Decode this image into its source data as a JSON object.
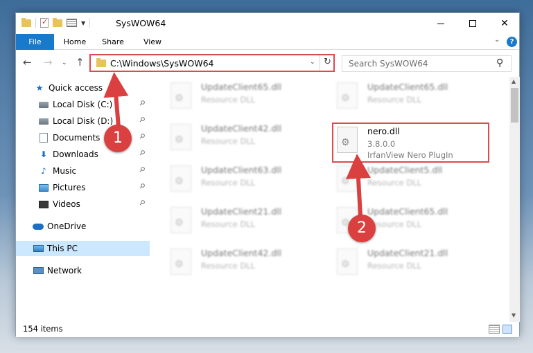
{
  "window": {
    "title": "SysWOW64"
  },
  "ribbon": {
    "tabs": [
      "File",
      "Home",
      "Share",
      "View"
    ]
  },
  "address": {
    "path": "C:\\Windows\\SysWOW64"
  },
  "search": {
    "placeholder": "Search SysWOW64"
  },
  "sidebar": {
    "items": [
      {
        "label": "Quick access",
        "icon": "star-icon"
      },
      {
        "label": "Local Disk (C:)",
        "icon": "drive-icon",
        "pinned": true
      },
      {
        "label": "Local Disk (D:)",
        "icon": "drive-icon",
        "pinned": true
      },
      {
        "label": "Documents",
        "icon": "documents-icon",
        "pinned": true
      },
      {
        "label": "Downloads",
        "icon": "download-icon",
        "pinned": true
      },
      {
        "label": "Music",
        "icon": "music-icon",
        "pinned": true
      },
      {
        "label": "Pictures",
        "icon": "pictures-icon",
        "pinned": true
      },
      {
        "label": "Videos",
        "icon": "videos-icon",
        "pinned": true
      },
      {
        "label": "OneDrive",
        "icon": "cloud-icon"
      },
      {
        "label": "This PC",
        "icon": "computer-icon",
        "selected": true
      },
      {
        "label": "Network",
        "icon": "network-icon"
      }
    ]
  },
  "files": [
    {
      "name": "UpdateClient65.dll",
      "line1": "Resource DLL",
      "line2": "",
      "blurred": true
    },
    {
      "name": "UpdateClient65.dll",
      "line1": "Resource DLL",
      "line2": "",
      "blurred": true
    },
    {
      "name": "UpdateClient42.dll",
      "line1": "Resource DLL",
      "line2": "",
      "blurred": true
    },
    {
      "name": "nero.dll",
      "line1": "3.8.0.0",
      "line2": "IrfanView Nero PlugIn",
      "blurred": false
    },
    {
      "name": "UpdateClient63.dll",
      "line1": "Resource DLL",
      "line2": "",
      "blurred": true
    },
    {
      "name": "UpdateClient5.dll",
      "line1": "Resource DLL",
      "line2": "",
      "blurred": true
    },
    {
      "name": "UpdateClient21.dll",
      "line1": "Resource DLL",
      "line2": "",
      "blurred": true
    },
    {
      "name": "UpdateClient65.dll",
      "line1": "Resource DLL",
      "line2": "",
      "blurred": true
    },
    {
      "name": "UpdateClient42.dll",
      "line1": "Resource DLL",
      "line2": "",
      "blurred": true
    },
    {
      "name": "UpdateClient21.dll",
      "line1": "Resource DLL",
      "line2": "",
      "blurred": true
    }
  ],
  "status": {
    "item_count": "154 items"
  },
  "annotations": {
    "step1": "1",
    "step2": "2"
  },
  "colors": {
    "accent": "#1979ca",
    "highlight": "#e0484f",
    "selection": "#cce8ff"
  }
}
